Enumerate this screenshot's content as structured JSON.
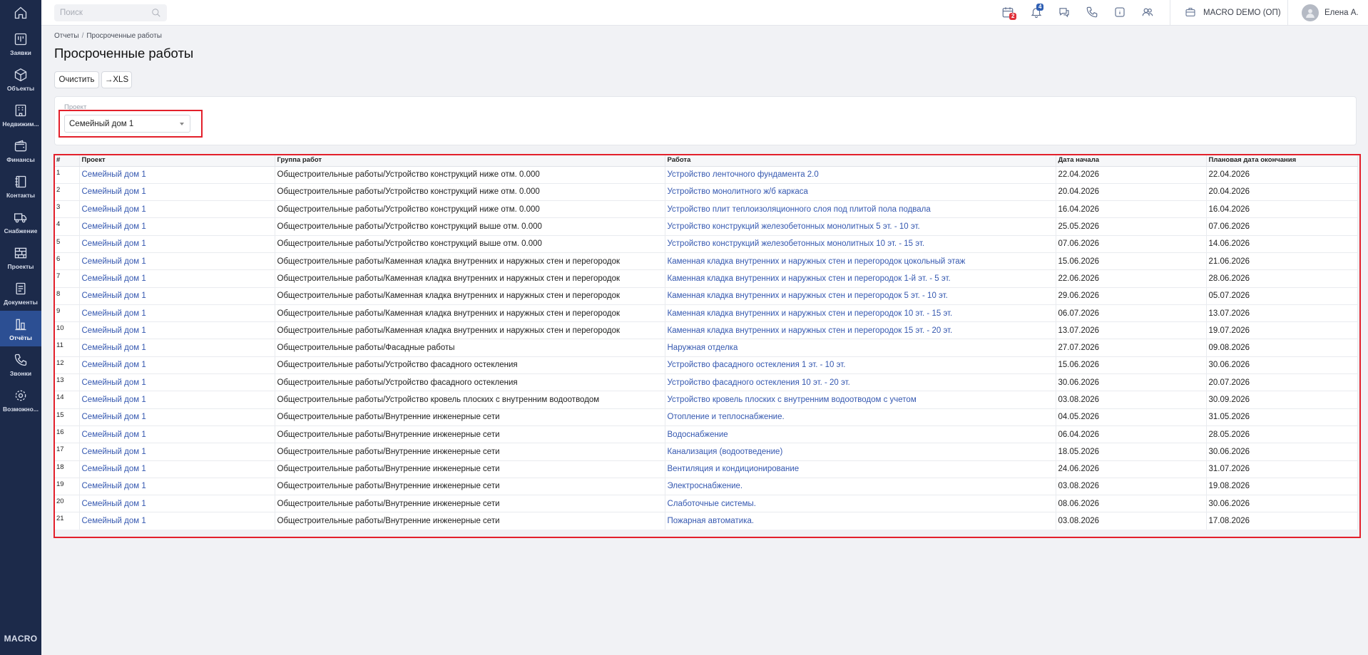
{
  "sidebar": {
    "items": [
      {
        "name": "home",
        "label": ""
      },
      {
        "name": "zayavki",
        "label": "Заявки"
      },
      {
        "name": "obekty",
        "label": "Объекты"
      },
      {
        "name": "nedvizhimost",
        "label": "Недвижим..."
      },
      {
        "name": "finansy",
        "label": "Финансы"
      },
      {
        "name": "kontakty",
        "label": "Контакты"
      },
      {
        "name": "snabzhenie",
        "label": "Снабжение"
      },
      {
        "name": "proekty",
        "label": "Проекты"
      },
      {
        "name": "dokumenty",
        "label": "Документы"
      },
      {
        "name": "otchety",
        "label": "Отчёты"
      },
      {
        "name": "zvonki",
        "label": "Звонки"
      },
      {
        "name": "vozmozhnosti",
        "label": "Возможно..."
      }
    ],
    "active": "Отчёты",
    "brand": "MACRO"
  },
  "topbar": {
    "search_placeholder": "Поиск",
    "calendar_badge": "2",
    "notifications_badge": "4",
    "company": "MACRO DEMO (ОП)",
    "user": "Елена А."
  },
  "breadcrumb": {
    "root": "Отчеты",
    "sep": "/",
    "current": "Просроченные работы"
  },
  "page_title": "Просроченные работы",
  "toolbar": {
    "clear_label": "Очистить",
    "xls_label": "→XLS"
  },
  "filter": {
    "label": "Проект",
    "value": "Семейный дом 1"
  },
  "table": {
    "headers": [
      "#",
      "Проект",
      "Группа работ",
      "Работа",
      "Дата начала",
      "Плановая дата окончания"
    ],
    "rows": [
      [
        "1",
        "Семейный дом 1",
        "Общестроительные работы/Устройство конструкций ниже отм. 0.000",
        "Устройство ленточного фундамента 2.0",
        "22.04.2026",
        "22.04.2026"
      ],
      [
        "2",
        "Семейный дом 1",
        "Общестроительные работы/Устройство конструкций ниже отм. 0.000",
        "Устройство монолитного ж/б каркаса",
        "20.04.2026",
        "20.04.2026"
      ],
      [
        "3",
        "Семейный дом 1",
        "Общестроительные работы/Устройство конструкций ниже отм. 0.000",
        "Устройство плит теплоизоляционного слоя под плитой пола подвала",
        "16.04.2026",
        "16.04.2026"
      ],
      [
        "4",
        "Семейный дом 1",
        "Общестроительные работы/Устройство конструкций выше отм. 0.000",
        "Устройство конструкций железобетонных монолитных 5 эт. - 10 эт.",
        "25.05.2026",
        "07.06.2026"
      ],
      [
        "5",
        "Семейный дом 1",
        "Общестроительные работы/Устройство конструкций выше отм. 0.000",
        "Устройство конструкций железобетонных монолитных 10 эт. - 15 эт.",
        "07.06.2026",
        "14.06.2026"
      ],
      [
        "6",
        "Семейный дом 1",
        "Общестроительные работы/Каменная кладка внутренних и наружных стен и перегородок",
        "Каменная кладка внутренних и наружных стен и перегородок цокольный этаж",
        "15.06.2026",
        "21.06.2026"
      ],
      [
        "7",
        "Семейный дом 1",
        "Общестроительные работы/Каменная кладка внутренних и наружных стен и перегородок",
        "Каменная кладка внутренних и наружных стен и перегородок 1-й эт. - 5 эт.",
        "22.06.2026",
        "28.06.2026"
      ],
      [
        "8",
        "Семейный дом 1",
        "Общестроительные работы/Каменная кладка внутренних и наружных стен и перегородок",
        "Каменная кладка внутренних и наружных стен и перегородок  5 эт. - 10 эт.",
        "29.06.2026",
        "05.07.2026"
      ],
      [
        "9",
        "Семейный дом 1",
        "Общестроительные работы/Каменная кладка внутренних и наружных стен и перегородок",
        "Каменная кладка внутренних и наружных стен и перегородок  10 эт. - 15 эт.",
        "06.07.2026",
        "13.07.2026"
      ],
      [
        "10",
        "Семейный дом 1",
        "Общестроительные работы/Каменная кладка внутренних и наружных стен и перегородок",
        "Каменная кладка внутренних и наружных стен и перегородок  15 эт. - 20 эт.",
        "13.07.2026",
        "19.07.2026"
      ],
      [
        "11",
        "Семейный дом 1",
        "Общестроительные работы/Фасадные работы",
        "Наружная отделка",
        "27.07.2026",
        "09.08.2026"
      ],
      [
        "12",
        "Семейный дом 1",
        "Общестроительные работы/Устройство фасадного остекления",
        "Устройство фасадного остекления 1 эт. - 10 эт.",
        "15.06.2026",
        "30.06.2026"
      ],
      [
        "13",
        "Семейный дом 1",
        "Общестроительные работы/Устройство фасадного остекления",
        "Устройство фасадного остекления 10 эт. - 20 эт.",
        "30.06.2026",
        "20.07.2026"
      ],
      [
        "14",
        "Семейный дом 1",
        "Общестроительные работы/Устройство кровель плоских с внутренним водоотводом",
        "Устройство кровель плоских с внутренним водоотводом с учетом",
        "03.08.2026",
        "30.09.2026"
      ],
      [
        "15",
        "Семейный дом 1",
        "Общестроительные работы/Внутренние инженерные сети",
        "Отопление и теплоснабжение.",
        "04.05.2026",
        "31.05.2026"
      ],
      [
        "16",
        "Семейный дом 1",
        "Общестроительные работы/Внутренние инженерные сети",
        "Водоснабжение",
        "06.04.2026",
        "28.05.2026"
      ],
      [
        "17",
        "Семейный дом 1",
        "Общестроительные работы/Внутренние инженерные сети",
        "Канализация (водоотведение)",
        "18.05.2026",
        "30.06.2026"
      ],
      [
        "18",
        "Семейный дом 1",
        "Общестроительные работы/Внутренние инженерные сети",
        "Вентиляция и кондиционирование",
        "24.06.2026",
        "31.07.2026"
      ],
      [
        "19",
        "Семейный дом 1",
        "Общестроительные работы/Внутренние инженерные сети",
        "Электроснабжение.",
        "03.08.2026",
        "19.08.2026"
      ],
      [
        "20",
        "Семейный дом 1",
        "Общестроительные работы/Внутренние инженерные сети",
        "Слаботочные системы.",
        "08.06.2026",
        "30.06.2026"
      ],
      [
        "21",
        "Семейный дом 1",
        "Общестроительные работы/Внутренние инженерные сети",
        "Пожарная автоматика.",
        "03.08.2026",
        "17.08.2026"
      ]
    ]
  },
  "colors": {
    "sidebar_bg": "#1c2a4a",
    "sidebar_active": "#2c4f93",
    "link": "#3558b0",
    "highlight": "#e3202b",
    "badge_red": "#e0303a",
    "badge_blue": "#2f5fb3"
  }
}
